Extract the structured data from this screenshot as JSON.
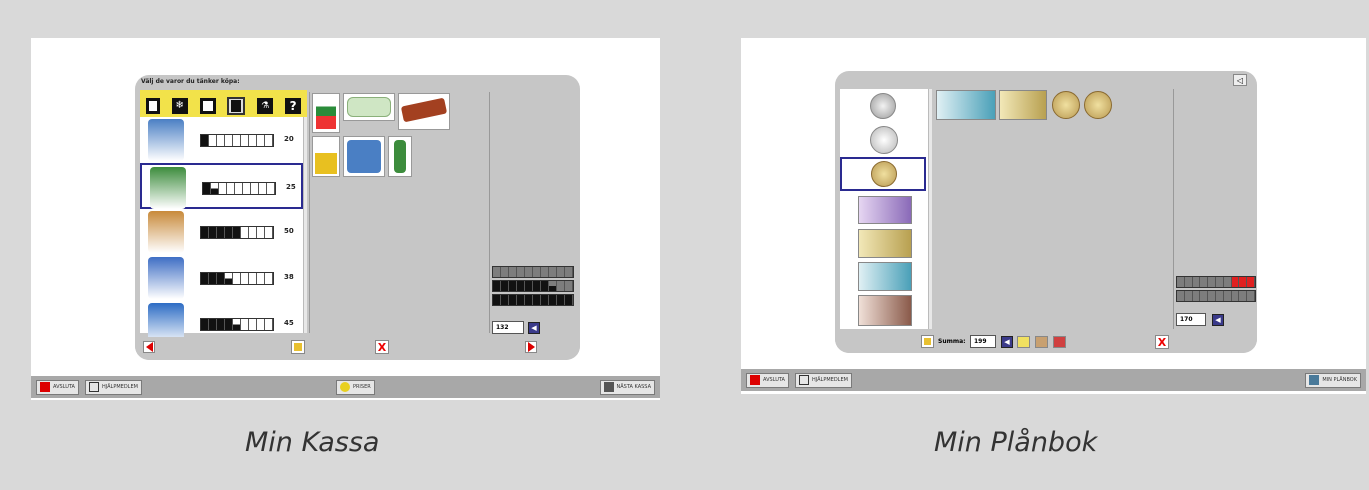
{
  "captions": {
    "left": "Min Kassa",
    "right": "Min Plånbok"
  },
  "kassa": {
    "header": "Välj de varor du tänker köpa:",
    "categories": [
      "Bröd",
      "Frys",
      "Kött",
      "Mejeri",
      "Städ",
      "Övrigt"
    ],
    "items": [
      {
        "name": "toilet-paper",
        "price": "20",
        "level": 1,
        "partial": false,
        "color": "#4a7fc4"
      },
      {
        "name": "dish-soap",
        "price": "25",
        "level": 1,
        "partial": true,
        "color": "#3c8c3c"
      },
      {
        "name": "detergent-box",
        "price": "50",
        "level": 5,
        "partial": false,
        "color": "#c88a3a"
      },
      {
        "name": "spray-cleaner",
        "price": "38",
        "level": 3,
        "partial": true,
        "color": "#3e6ec4"
      },
      {
        "name": "toilet-cleaner",
        "price": "45",
        "level": 4,
        "partial": true,
        "color": "#2c6cc4"
      }
    ],
    "total": "132",
    "taskbar": {
      "quit": "AVSLUTA",
      "help": "HJÄLPMEDLEM",
      "prices": "PRISER",
      "next": "NÄSTA KASSA"
    }
  },
  "planbok": {
    "sum_label": "Summa:",
    "sum_value": "199",
    "total": "170",
    "taskbar": {
      "quit": "AVSLUTA",
      "help": "HJÄLPMEDLEM",
      "next": "MIN PLÅNBOK"
    },
    "denominations": [
      "1 kr",
      "5 kr",
      "10 kr",
      "20 kr",
      "50 kr",
      "100 kr",
      "500 kr"
    ]
  }
}
